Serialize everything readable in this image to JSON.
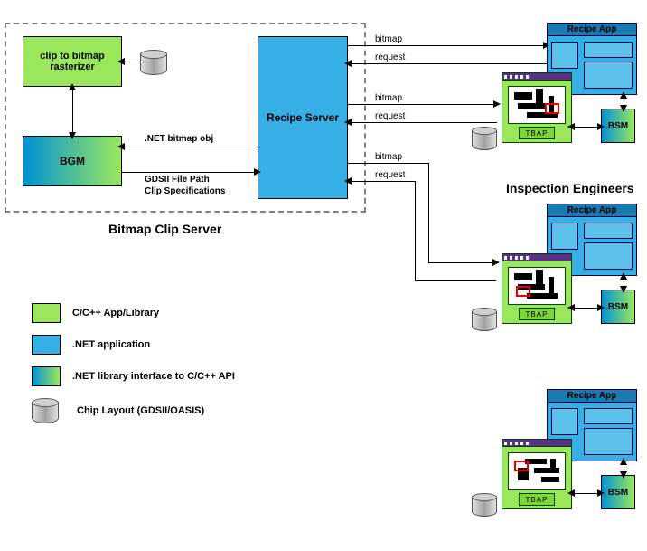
{
  "server": {
    "title": "Bitmap Clip Server",
    "rasterizer": "clip to bitmap rasterizer",
    "bgm": "BGM",
    "recipe_server": "Recipe Server",
    "bitmap_obj": ".NET bitmap obj",
    "gdsii_path": "GDSII File Path",
    "clip_specs": "Clip Specifications"
  },
  "flows": {
    "bitmap": "bitmap",
    "request": "request"
  },
  "clients": {
    "title": "Inspection Engineers",
    "recipe_app": "Recipe App",
    "tbap": "TBAP",
    "bsm": "BSM"
  },
  "legend": {
    "cpp": "C/C++ App/Library",
    "dotnet": ".NET application",
    "interface": ".NET library interface to C/C++ API",
    "chip": "Chip Layout (GDSII/OASIS)"
  }
}
